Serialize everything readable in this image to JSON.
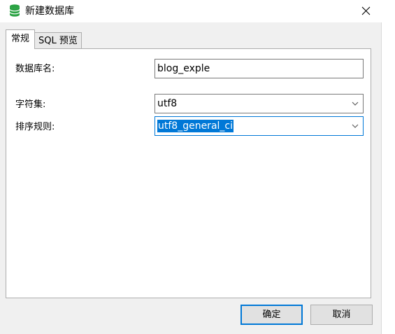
{
  "window": {
    "title": "新建数据库",
    "close_icon": "close-icon",
    "app_icon": "database-icon"
  },
  "tabs": [
    {
      "label": "常规",
      "active": true
    },
    {
      "label": "SQL 预览",
      "active": false
    }
  ],
  "form": {
    "db_name_label": "数据库名:",
    "db_name_value": "blog_exple",
    "charset_label": "字符集:",
    "charset_value": "utf8",
    "collation_label": "排序规则:",
    "collation_value": "utf8_general_ci"
  },
  "buttons": {
    "ok": "确定",
    "cancel": "取消"
  },
  "colors": {
    "accent": "#0078d7",
    "db_icon": "#2aa243"
  }
}
